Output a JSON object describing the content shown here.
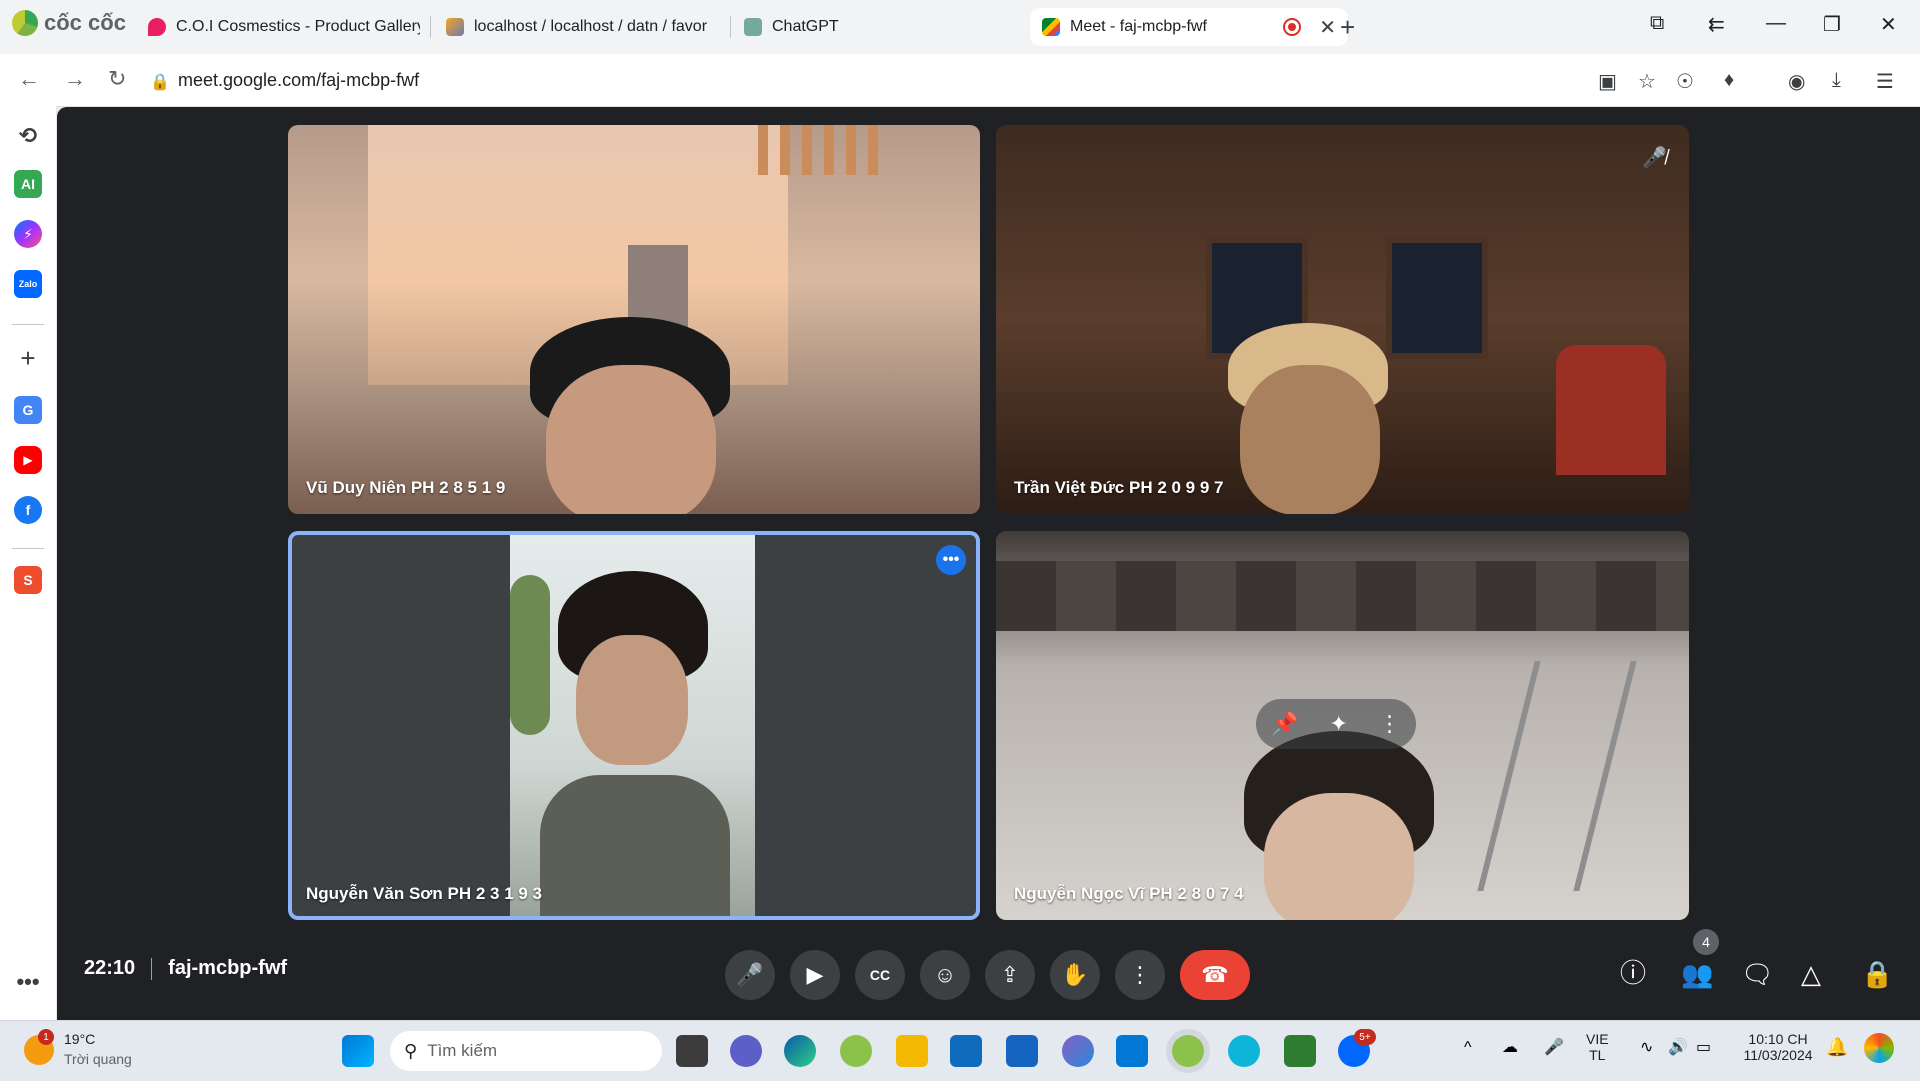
{
  "browser": {
    "brand": "cốc cốc",
    "tabs": [
      {
        "title": "C.O.I Cosmestics - Product Gallery"
      },
      {
        "title": "localhost / localhost / datn / favor"
      },
      {
        "title": "ChatGPT"
      },
      {
        "title": "Meet - faj-mcbp-fwf",
        "active": true
      }
    ],
    "url": "meet.google.com/faj-mcbp-fwf"
  },
  "sidebar": {
    "items": [
      "history-icon",
      "ai-assistant-icon",
      "messenger-icon",
      "zalo-icon",
      "add-icon",
      "translate-icon",
      "youtube-icon",
      "facebook-icon",
      "shopee-icon",
      "more-icon"
    ],
    "ai_label": "AI",
    "zalo_label": "Zalo"
  },
  "meet": {
    "participants": [
      {
        "name": "Vũ Duy Niên PH 2 8 5 1 9"
      },
      {
        "name": "Trần Việt Đức PH 2 0 9 9 7",
        "muted": true
      },
      {
        "name": "Nguyễn Văn Sơn PH 2 3 1 9 3",
        "active_speaker": true
      },
      {
        "name": "Nguyễn Ngọc Vĩ PH 2 8 0 7 4"
      }
    ],
    "time": "22:10",
    "meeting_code": "faj-mcbp-fwf",
    "people_count": "4"
  },
  "taskbar": {
    "weather_temp": "19°C",
    "weather_desc": "Trời quang",
    "weather_badge": "1",
    "search_placeholder": "Tìm kiếm",
    "lang_top": "VIE",
    "lang_bottom": "TL",
    "clock_time": "10:10 CH",
    "clock_date": "11/03/2024",
    "zalo_badge": "5+"
  },
  "colors": {
    "meet_bg": "#202124",
    "end_call": "#ea4335",
    "active_speaker_border": "#8ab4f8",
    "accent_blue": "#1a73e8"
  }
}
